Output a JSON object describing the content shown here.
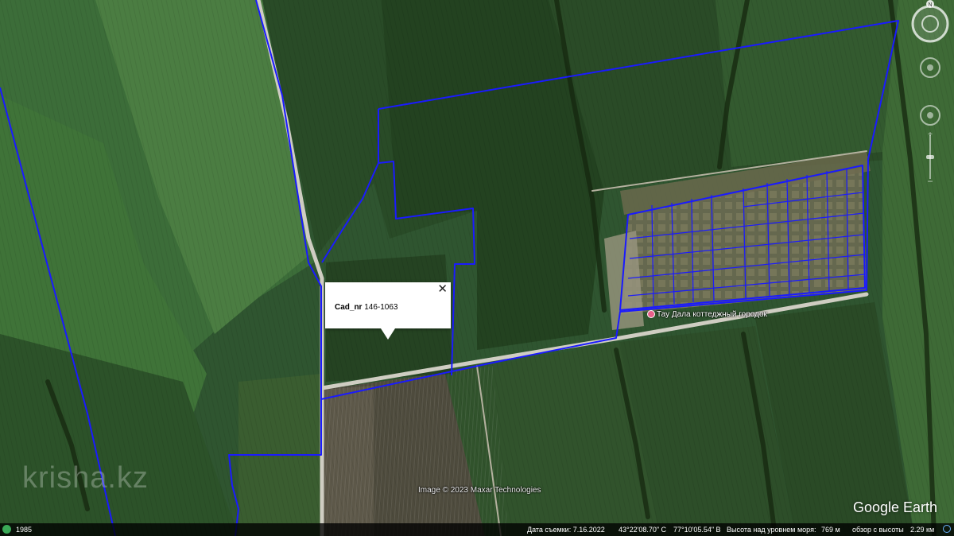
{
  "popup": {
    "key": "Cad_nr",
    "value": "146-1063",
    "close_label": "✕"
  },
  "place": {
    "name": "Тау Дала коттеджный городок"
  },
  "image_credit": "Image © 2023 Maxar Technologies",
  "watermark": "krisha.kz",
  "logo": "Google Earth",
  "navigation": {
    "north_label": "N"
  },
  "status_bar": {
    "historical_year": "1985",
    "capture_date": "Дата съемки: 7.16.2022",
    "latitude": "43°22'08.70\" С",
    "longitude": "77°10'05.54\" В",
    "elevation_label": "Высота над уровнем моря:",
    "elevation_value": "769 м",
    "eye_alt_label": "обзор с высоты",
    "eye_alt_value": "2.29 км"
  },
  "colors": {
    "parcel_outline": "#1a1aff",
    "road": "#c9c7bd",
    "field_dark": "#24421f",
    "field_light": "#4e7a3e",
    "status_bar_bg": "#000000"
  },
  "icons": {
    "compass": "compass-ring-icon",
    "look_joystick": "look-joystick-icon",
    "zoom_slider": "zoom-slider-icon",
    "place_marker": "pink-pin-icon",
    "history": "historical-imagery-icon",
    "eye_altitude": "circle-icon"
  }
}
